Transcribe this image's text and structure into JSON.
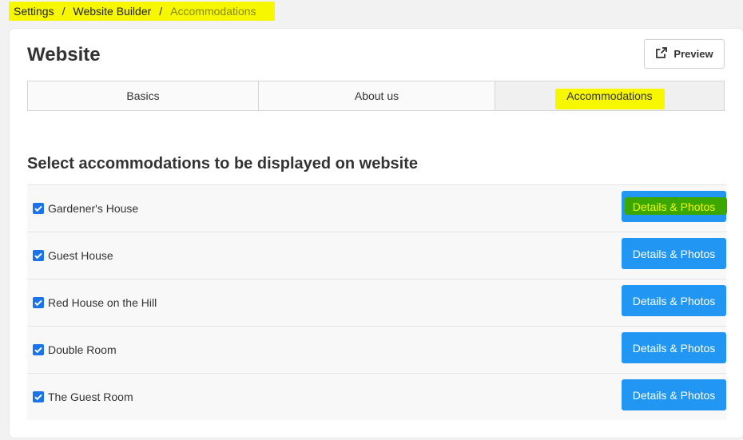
{
  "breadcrumb": {
    "items": [
      "Settings",
      "Website Builder",
      "Accommodations"
    ],
    "separator": "/"
  },
  "page": {
    "title": "Website",
    "preview_label": "Preview"
  },
  "tabs": [
    {
      "label": "Basics",
      "active": false
    },
    {
      "label": "About us",
      "active": false
    },
    {
      "label": "Accommodations",
      "active": true
    }
  ],
  "section": {
    "title": "Select accommodations to be displayed on website"
  },
  "accommodations": [
    {
      "name": "Gardener's House",
      "checked": true,
      "button": "Details & Photos"
    },
    {
      "name": "Guest House",
      "checked": true,
      "button": "Details & Photos"
    },
    {
      "name": "Red House on the Hill",
      "checked": true,
      "button": "Details & Photos"
    },
    {
      "name": "Double Room",
      "checked": true,
      "button": "Details & Photos"
    },
    {
      "name": "The Guest Room",
      "checked": true,
      "button": "Details & Photos"
    }
  ],
  "icons": {
    "preview": "external-link-icon",
    "checkbox": "checkmark-icon"
  },
  "colors": {
    "primary_button": "#2196f3",
    "highlight_yellow": "#f7f700",
    "highlight_green": "#3aa800",
    "checkbox": "#1a73e8"
  }
}
